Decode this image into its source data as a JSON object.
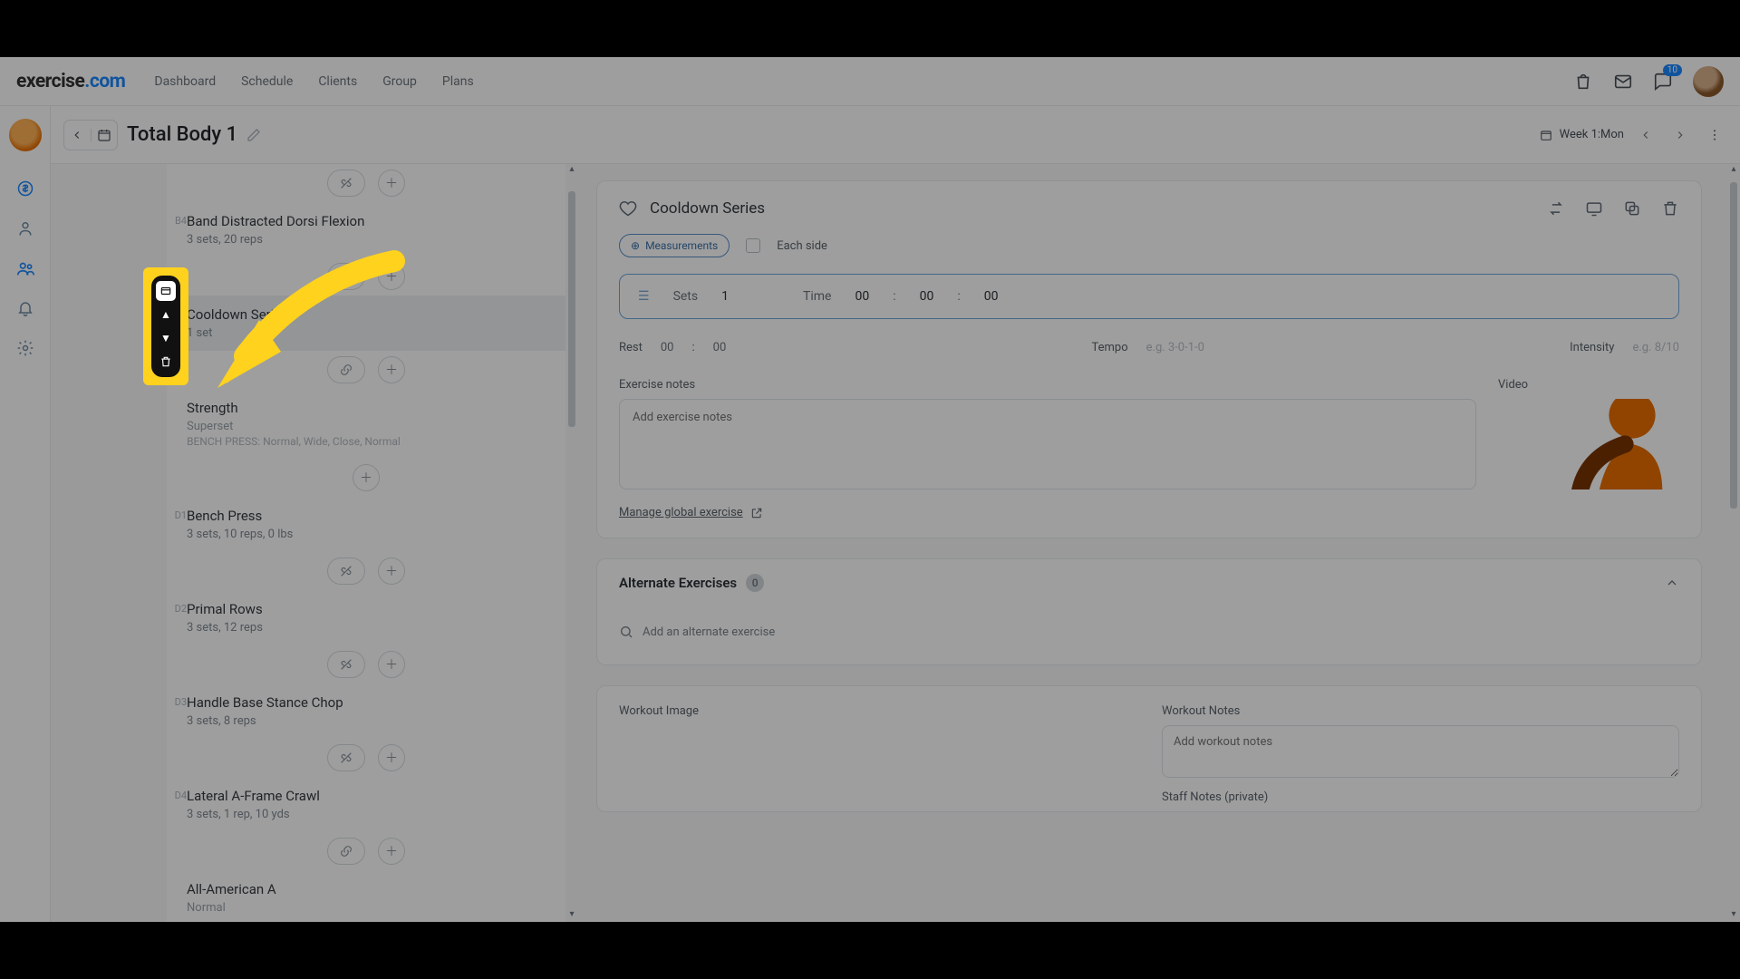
{
  "brand": {
    "name": "exercise",
    "suffix": ".com"
  },
  "nav": {
    "dashboard": "Dashboard",
    "schedule": "Schedule",
    "clients": "Clients",
    "group": "Group",
    "plans": "Plans"
  },
  "notifications": {
    "count": "10"
  },
  "page": {
    "title": "Total Body 1",
    "week_label": "Week 1:Mon"
  },
  "list": {
    "b4": {
      "code": "B4",
      "name": "Band Distracted Dorsi Flexion",
      "meta": "3 sets, 20 reps"
    },
    "cooldown": {
      "name": "Cooldown Series",
      "meta": "1 set"
    },
    "strength": {
      "name": "Strength",
      "sub": "Superset",
      "detail": "BENCH PRESS: Normal, Wide, Close, Normal"
    },
    "d1": {
      "code": "D1",
      "name": "Bench Press",
      "meta": "3 sets, 10 reps, 0 lbs"
    },
    "d2": {
      "code": "D2",
      "name": "Primal Rows",
      "meta": "3 sets, 12 reps"
    },
    "d3": {
      "code": "D3",
      "name": "Handle Base Stance Chop",
      "meta": "3 sets, 8 reps"
    },
    "d4": {
      "code": "D4",
      "name": "Lateral A-Frame Crawl",
      "meta": "3 sets, 1 rep, 10 yds"
    },
    "all_american": {
      "name": "All-American A",
      "sub": "Normal"
    }
  },
  "detail": {
    "title": "Cooldown Series",
    "measurements_label": "Measurements",
    "each_side_label": "Each side",
    "sets_label": "Sets",
    "sets_value": "1",
    "time_label": "Time",
    "time_h": "00",
    "time_m": "00",
    "time_s": "00",
    "rest_label": "Rest",
    "rest_m": "00",
    "rest_s": "00",
    "tempo_label": "Tempo",
    "tempo_ph": "e.g. 3-0-1-0",
    "intensity_label": "Intensity",
    "intensity_ph": "e.g. 8/10",
    "exercise_notes_label": "Exercise notes",
    "exercise_notes_ph": "Add exercise notes",
    "video_label": "Video",
    "manage_link": "Manage global exercise "
  },
  "alt": {
    "header": "Alternate Exercises",
    "count": "0",
    "add_label": "Add an alternate exercise"
  },
  "bottom": {
    "workout_image_label": "Workout Image",
    "workout_notes_label": "Workout Notes",
    "workout_notes_ph": "Add workout notes",
    "staff_notes_label": "Staff Notes (private)"
  },
  "colon": ":"
}
